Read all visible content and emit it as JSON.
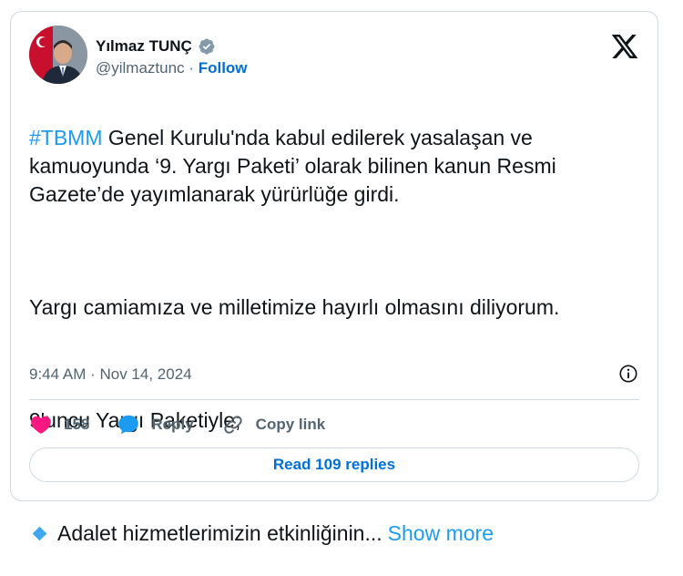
{
  "author": {
    "name": "Yılmaz TUNÇ",
    "handle": "@yilmaztunc",
    "separator": "·",
    "follow_label": "Follow"
  },
  "tweet": {
    "hashtag": "#TBMM",
    "line1_rest": " Genel Kurulu'nda kabul edilerek yasalaşan ve kamuoyunda ‘9. Yargı Paketi’ olarak bilinen kanun Resmi Gazete’de yayımlanarak yürürlüğe girdi.",
    "line2": "Yargı camiamıza ve milletimize hayırlı olmasını diliyorum.",
    "line3": "9'uncu Yargı Paketiyle;",
    "bullet_text": "Adalet hizmetlerimizin etkinliğinin...",
    "show_more": "Show more"
  },
  "meta": {
    "timestamp": "9:44 AM · Nov 14, 2024"
  },
  "actions": {
    "likes": "158",
    "reply_label": "Reply",
    "copy_link_label": "Copy link"
  },
  "read_replies_label": "Read 109 replies",
  "colors": {
    "accent": "#1d9bf0",
    "follow": "#006fd6",
    "like": "#f91880",
    "reply_bubble": "#1d9bf0",
    "bullet": "#3fa7ef"
  },
  "icons": [
    "verified-badge-icon",
    "x-logo-icon",
    "info-icon",
    "heart-icon",
    "reply-icon",
    "link-icon"
  ]
}
